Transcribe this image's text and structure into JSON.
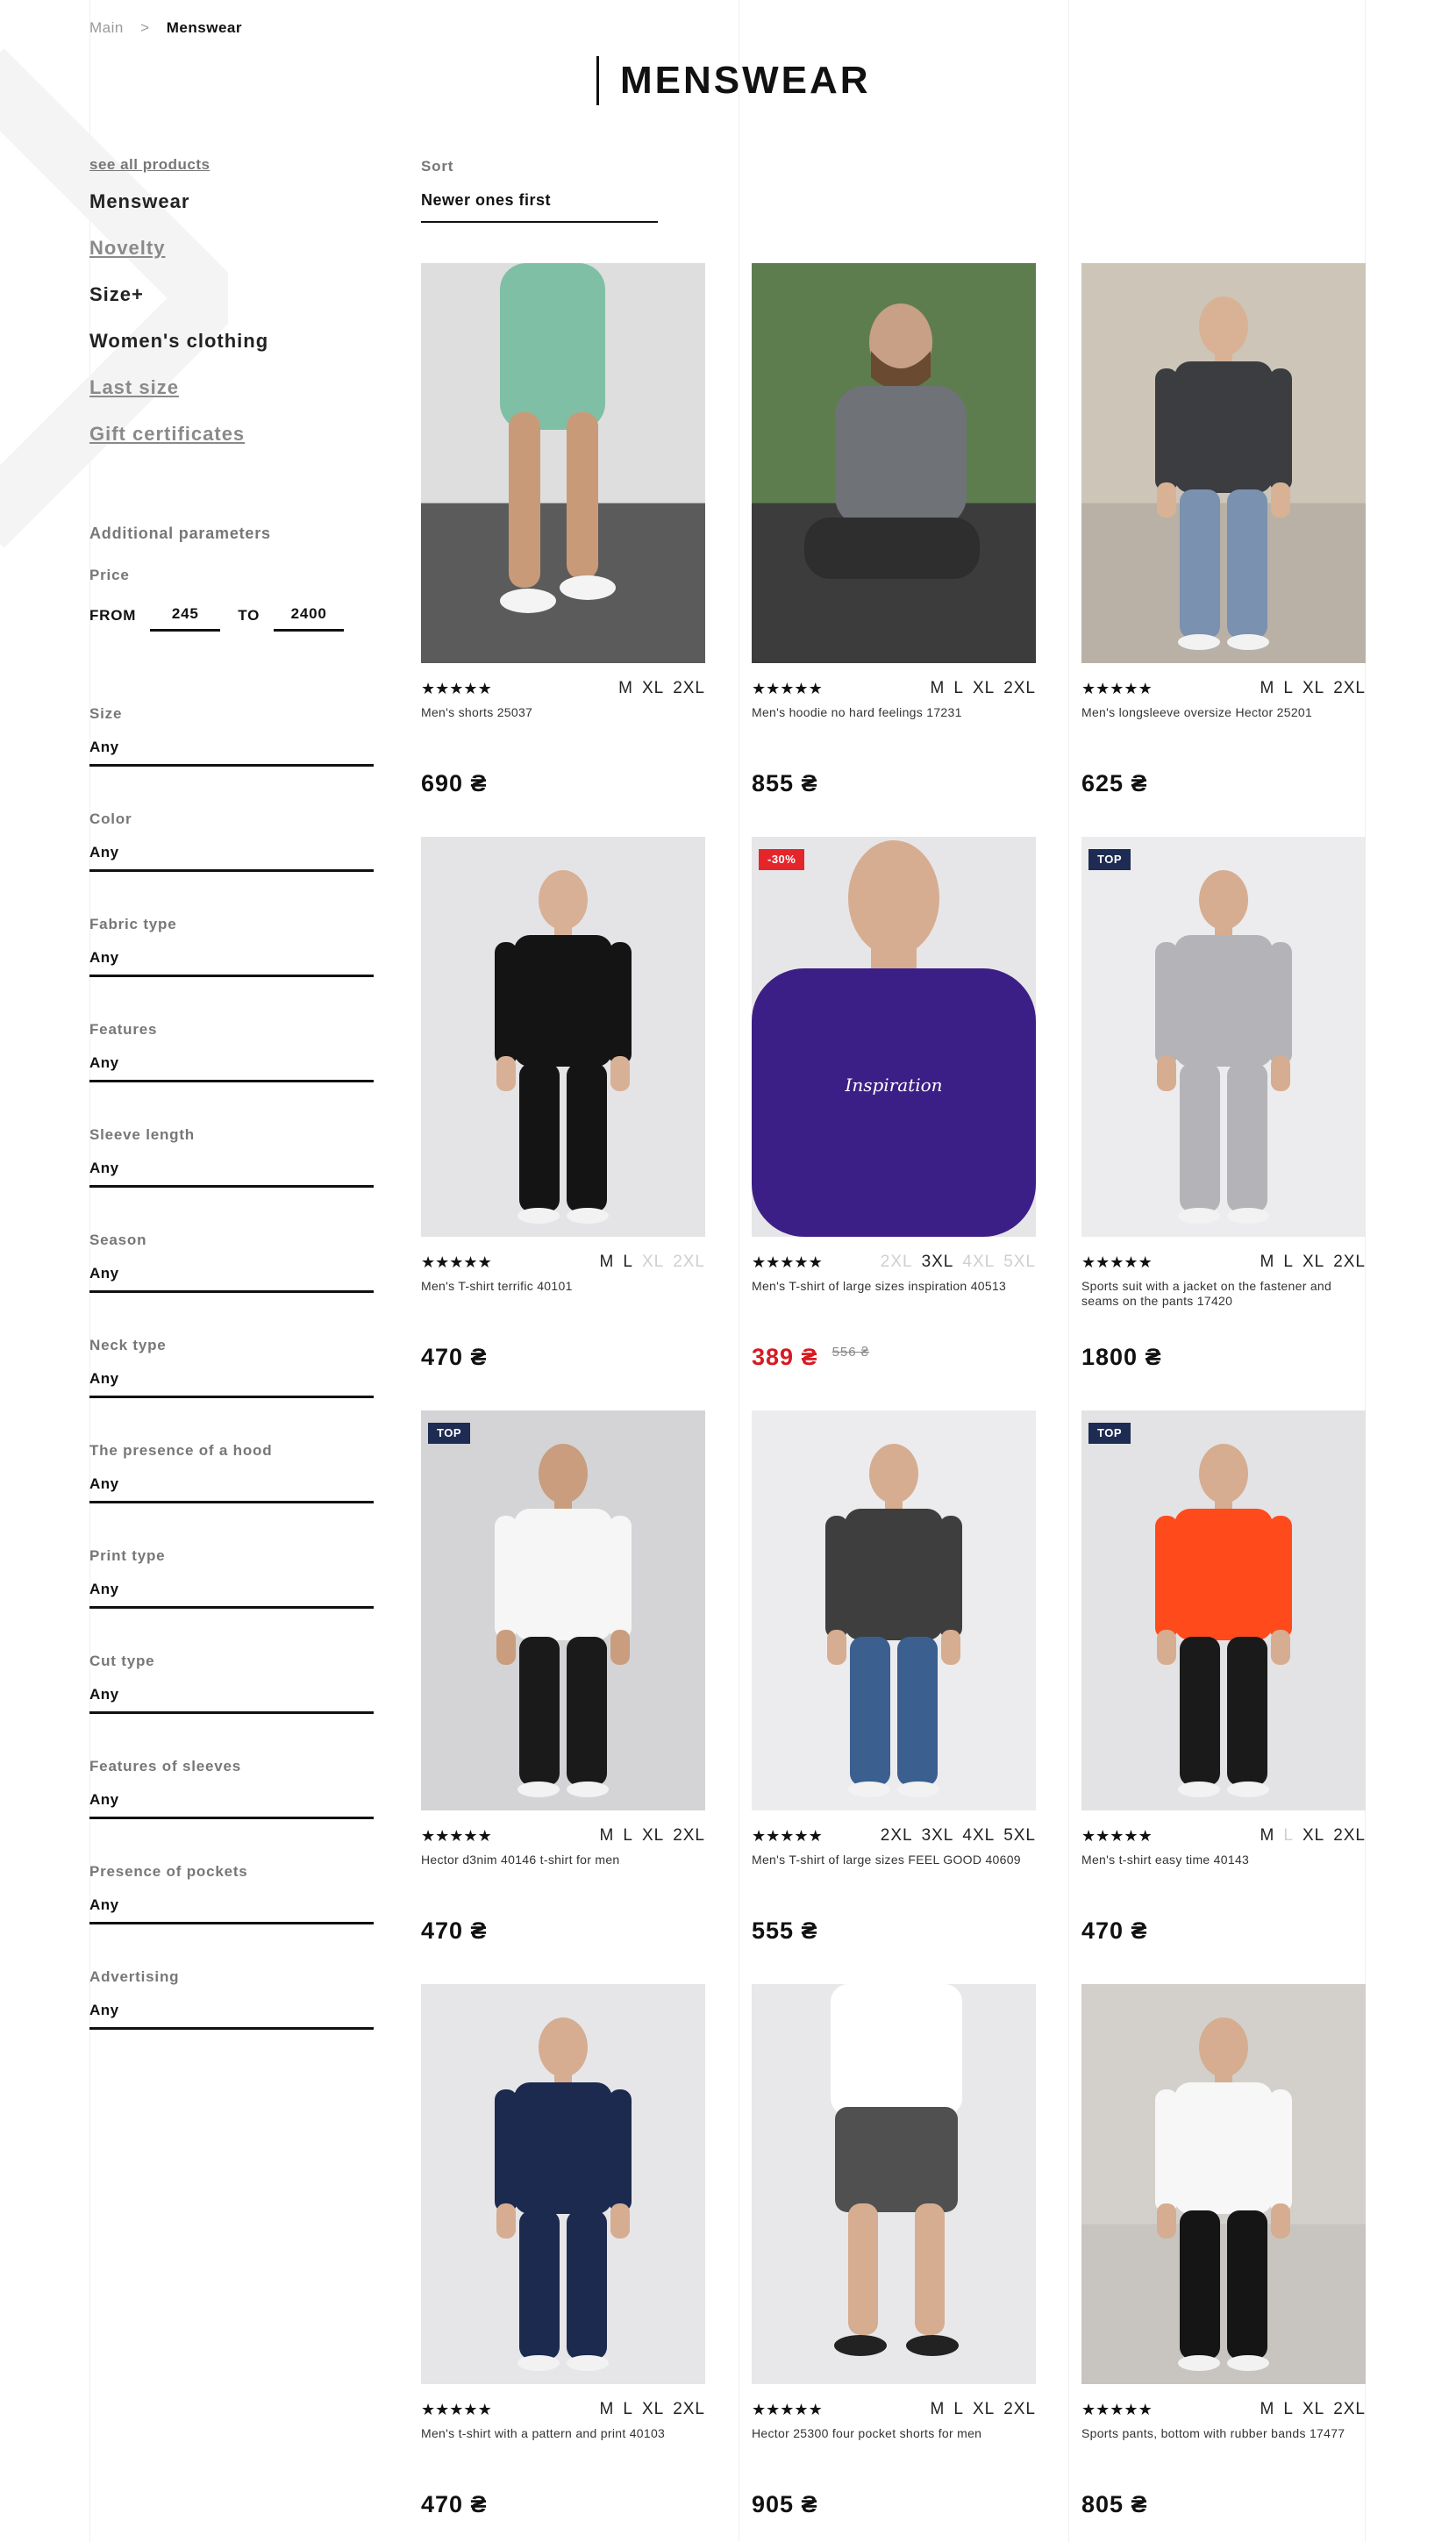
{
  "breadcrumb": {
    "root": "Main",
    "separator": ">",
    "current": "Menswear"
  },
  "page_title": "MENSWEAR",
  "sidebar": {
    "see_all": "see all products",
    "categories": [
      {
        "label": "Menswear"
      },
      {
        "label": "Novelty"
      },
      {
        "label": "Size+"
      },
      {
        "label": "Women's clothing"
      },
      {
        "label": "Last size"
      },
      {
        "label": "Gift certificates"
      }
    ]
  },
  "additional_parameters": "Additional parameters",
  "price_filter": {
    "label": "Price",
    "from_label": "FROM",
    "from": "245",
    "to_label": "TO",
    "to": "2400"
  },
  "filters": [
    {
      "label": "Size",
      "value": "Any"
    },
    {
      "label": "Color",
      "value": "Any"
    },
    {
      "label": "Fabric type",
      "value": "Any"
    },
    {
      "label": "Features",
      "value": "Any"
    },
    {
      "label": "Sleeve length",
      "value": "Any"
    },
    {
      "label": "Season",
      "value": "Any"
    },
    {
      "label": "Neck type",
      "value": "Any"
    },
    {
      "label": "The presence of a hood",
      "value": "Any"
    },
    {
      "label": "Print type",
      "value": "Any"
    },
    {
      "label": "Cut type",
      "value": "Any"
    },
    {
      "label": "Features of sleeves",
      "value": "Any"
    },
    {
      "label": "Presence of pockets",
      "value": "Any"
    },
    {
      "label": "Advertising",
      "value": "Any"
    }
  ],
  "sort": {
    "label": "Sort",
    "value": "Newer ones first"
  },
  "rating_icon": "star-icon",
  "colors": {
    "sale_badge": "#e4262b",
    "top_badge": "#1e2b52",
    "sale_price": "#d71a21"
  },
  "products": [
    {
      "name": "Men's shorts 25037",
      "price": "690 ₴",
      "rating": 5,
      "sizes": [
        "M",
        "XL",
        "2XL"
      ],
      "unavailable": [],
      "badge": ""
    },
    {
      "name": "Men's hoodie no hard feelings 17231",
      "price": "855 ₴",
      "rating": 5,
      "sizes": [
        "M",
        "L",
        "XL",
        "2XL"
      ],
      "unavailable": [],
      "badge": ""
    },
    {
      "name": "Men's longsleeve oversize Hector 25201",
      "price": "625 ₴",
      "rating": 5,
      "sizes": [
        "M",
        "L",
        "XL",
        "2XL"
      ],
      "unavailable": [],
      "badge": ""
    },
    {
      "name": "Men's T-shirt terrific 40101",
      "price": "470 ₴",
      "rating": 5,
      "sizes": [
        "M",
        "L",
        "XL",
        "2XL"
      ],
      "unavailable": [
        "XL",
        "2XL"
      ],
      "badge": ""
    },
    {
      "name": "Men's T-shirt of large sizes inspiration 40513",
      "price": "389 ₴",
      "old_price": "556 ₴",
      "rating": 5,
      "sizes": [
        "2XL",
        "3XL",
        "4XL",
        "5XL"
      ],
      "unavailable": [
        "2XL",
        "4XL",
        "5XL"
      ],
      "badge": "-30%"
    },
    {
      "name": "Sports suit with a jacket on the fastener and seams on the pants 17420",
      "price": "1800 ₴",
      "rating": 5,
      "sizes": [
        "M",
        "L",
        "XL",
        "2XL"
      ],
      "unavailable": [],
      "badge": "TOP"
    },
    {
      "name": "Hector d3nim 40146 t-shirt for men",
      "price": "470 ₴",
      "rating": 5,
      "sizes": [
        "M",
        "L",
        "XL",
        "2XL"
      ],
      "unavailable": [],
      "badge": "TOP"
    },
    {
      "name": "Men's T-shirt of large sizes FEEL GOOD 40609",
      "price": "555 ₴",
      "rating": 5,
      "sizes": [
        "2XL",
        "3XL",
        "4XL",
        "5XL"
      ],
      "unavailable": [],
      "badge": ""
    },
    {
      "name": "Men's t-shirt easy time 40143",
      "price": "470 ₴",
      "rating": 5,
      "sizes": [
        "M",
        "L",
        "XL",
        "2XL"
      ],
      "unavailable": [
        "L"
      ],
      "badge": "TOP"
    },
    {
      "name": "Men's t-shirt with a pattern and print 40103",
      "price": "470 ₴",
      "rating": 5,
      "sizes": [
        "M",
        "L",
        "XL",
        "2XL"
      ],
      "unavailable": [],
      "badge": ""
    },
    {
      "name": "Hector 25300 four pocket shorts for men",
      "price": "905 ₴",
      "rating": 5,
      "sizes": [
        "M",
        "L",
        "XL",
        "2XL"
      ],
      "unavailable": [],
      "badge": ""
    },
    {
      "name": "Sports pants, bottom with rubber bands 17477",
      "price": "805 ₴",
      "rating": 5,
      "sizes": [
        "M",
        "L",
        "XL",
        "2XL"
      ],
      "unavailable": [],
      "badge": ""
    }
  ]
}
